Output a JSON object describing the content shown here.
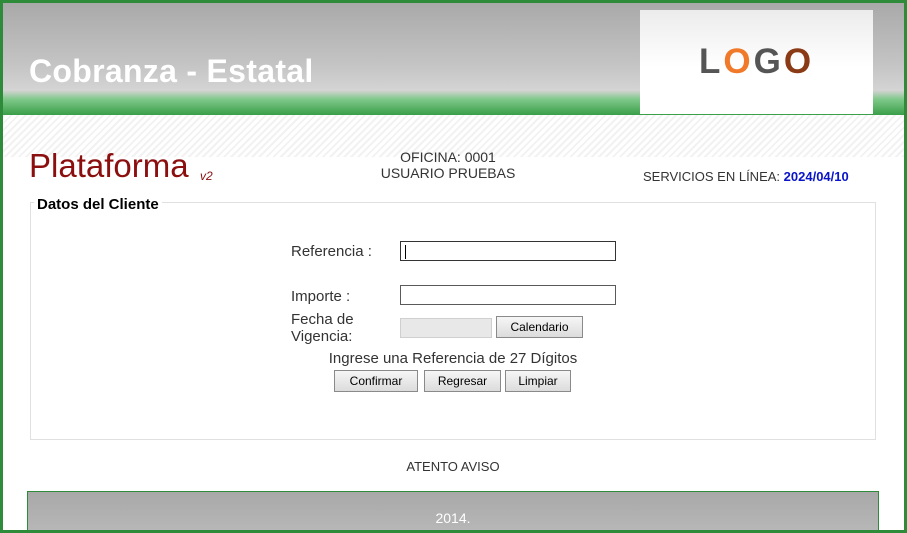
{
  "header": {
    "app_title": "Cobranza - Estatal",
    "logo": {
      "letters": [
        "L",
        "O",
        "G",
        "O"
      ]
    }
  },
  "platform": {
    "title": "Plataforma",
    "version": "v2"
  },
  "office": {
    "office_line": "OFICINA: 0001",
    "user_line": "USUARIO PRUEBAS"
  },
  "services": {
    "label": "SERVICIOS EN LÍNEA:",
    "date": "2024/04/10"
  },
  "form": {
    "legend": "Datos del Cliente",
    "reference_label": "Referencia :",
    "reference_value": "",
    "amount_label": "Importe :",
    "amount_value": "",
    "validity_label_line1": "Fecha de",
    "validity_label_line2": "Vigencia:",
    "validity_value": "",
    "calendar_button": "Calendario",
    "hint": "Ingrese una Referencia de 27 Dígitos",
    "confirm_button": "Confirmar",
    "back_button": "Regresar",
    "clear_button": "Limpiar"
  },
  "notice": "ATENTO AVISO",
  "footer": {
    "text": "2014."
  },
  "colors": {
    "frame_border": "#2e8b3a",
    "platform_title": "#8b0f0f",
    "service_date": "#0a14c8"
  }
}
